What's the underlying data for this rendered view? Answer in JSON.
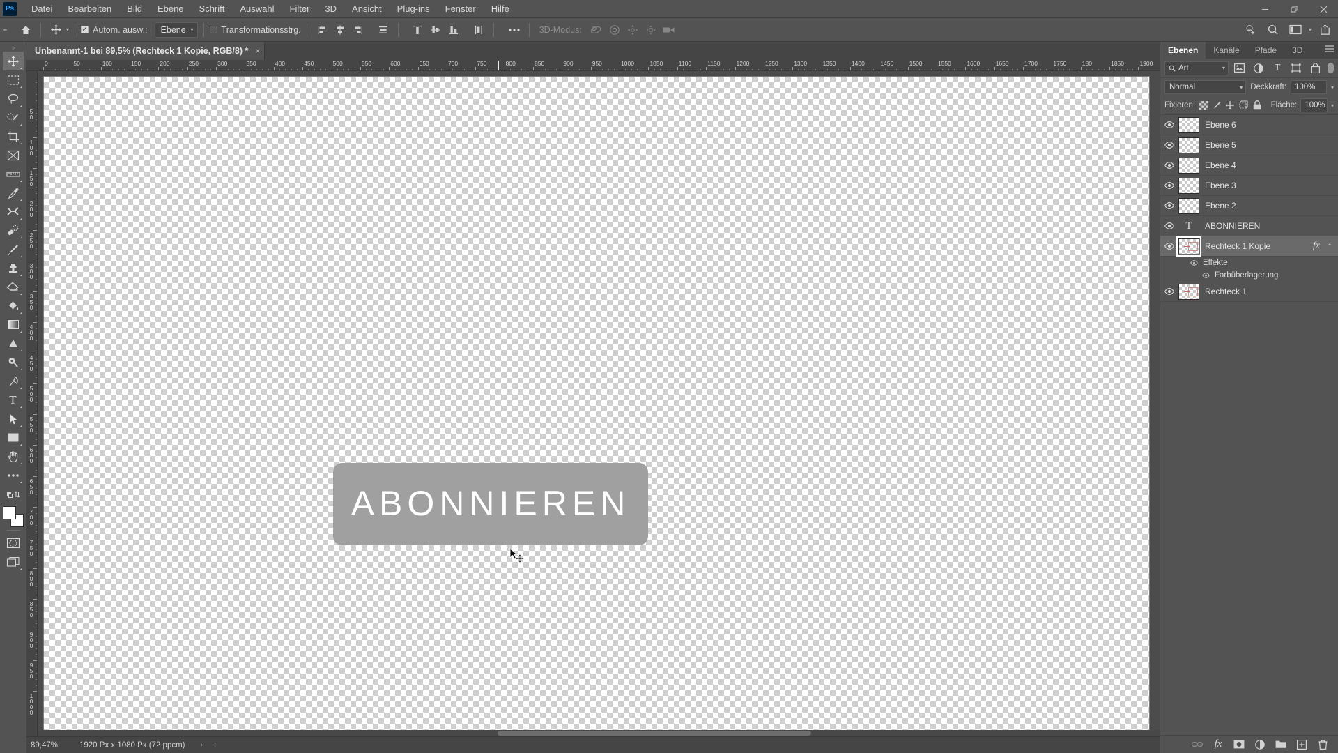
{
  "app": {
    "logo": "Ps"
  },
  "menubar": {
    "items": [
      "Datei",
      "Bearbeiten",
      "Bild",
      "Ebene",
      "Schrift",
      "Auswahl",
      "Filter",
      "3D",
      "Ansicht",
      "Plug-ins",
      "Fenster",
      "Hilfe"
    ],
    "window_controls": [
      "minimize-icon",
      "restore-icon",
      "close-icon"
    ]
  },
  "options_bar": {
    "home_icon": "home-icon",
    "tool_icon": "move-tool-icon",
    "auto_select": {
      "label": "Autom. ausw.:",
      "checked": true
    },
    "auto_select_scope": {
      "value": "Ebene"
    },
    "transform_controls": {
      "label": "Transformationsstrg.",
      "checked": false
    },
    "align_group_1": [
      "align-left-icon",
      "align-center-horizontal-icon",
      "align-right-icon",
      "distribute-horizontal-icon"
    ],
    "align_group_2": [
      "align-top-icon",
      "align-middle-vertical-icon",
      "align-bottom-icon",
      "distribute-vertical-icon"
    ],
    "more_icon": "more-options-icon",
    "three_d_mode": {
      "label": "3D-Modus:",
      "icons": [
        "orbit-3d-icon",
        "roll-3d-icon",
        "pan-3d-icon",
        "slide-3d-icon",
        "scale-3d-icon"
      ]
    },
    "right_icons": [
      "share-proof-icon",
      "search-icon",
      "workspace-icon",
      "chevron-down-icon",
      "export-icon"
    ]
  },
  "document_tab": {
    "title": "Unbenannt-1 bei 89,5% (Rechteck 1 Kopie, RGB/8) *",
    "close": "×"
  },
  "toolbar": {
    "tools": [
      {
        "name": "move-tool",
        "selected": true
      },
      {
        "name": "rectangular-marquee-tool",
        "selected": false
      },
      {
        "name": "lasso-tool",
        "selected": false
      },
      {
        "name": "object-selection-tool",
        "selected": false
      },
      {
        "name": "crop-tool",
        "selected": false
      },
      {
        "name": "frame-tool",
        "selected": false
      },
      {
        "name": "eyedropper-ruler-tool",
        "selected": false
      },
      {
        "name": "eyedropper-tool",
        "selected": false
      },
      {
        "name": "spot-healing-brush-tool",
        "selected": false
      },
      {
        "name": "patch-tool",
        "selected": false
      },
      {
        "name": "brush-tool",
        "selected": false
      },
      {
        "name": "clone-stamp-tool",
        "selected": false
      },
      {
        "name": "eraser-tool",
        "selected": false
      },
      {
        "name": "paint-bucket-tool",
        "selected": false
      },
      {
        "name": "gradient-tool",
        "selected": false
      },
      {
        "name": "blur-sharpen-tool",
        "selected": false
      },
      {
        "name": "dodge-burn-tool",
        "selected": false
      },
      {
        "name": "pen-tool",
        "selected": false
      },
      {
        "name": "type-tool",
        "selected": false
      },
      {
        "name": "path-selection-tool",
        "selected": false
      },
      {
        "name": "rectangle-shape-tool",
        "selected": false
      },
      {
        "name": "hand-tool",
        "selected": false
      },
      {
        "name": "more-tools",
        "selected": false
      },
      {
        "name": "edit-toolbar",
        "selected": false
      }
    ],
    "foreground_color": "#ffffff",
    "background_color": "#ffffff",
    "quick_mask_icon": "quick-mask-icon",
    "screen_mode_icon": "screen-mode-icon"
  },
  "rulers": {
    "h_ticks": [
      "0",
      "50",
      "100",
      "150",
      "200",
      "250",
      "300",
      "350",
      "400",
      "450",
      "500",
      "550",
      "600",
      "650",
      "700",
      "750",
      "800",
      "850",
      "900",
      "950",
      "1000",
      "1050",
      "1100",
      "1150",
      "1200",
      "1250",
      "1300",
      "1350",
      "1400",
      "1450",
      "1500",
      "1550",
      "1600",
      "1650",
      "1700",
      "1750",
      "1800"
    ],
    "v_ticks": [
      "50",
      "100",
      "150",
      "200",
      "250",
      "300",
      "350",
      "400",
      "450",
      "500",
      "550",
      "600",
      "650",
      "700",
      "750",
      "800",
      "850",
      "900",
      "950"
    ],
    "unit": "Px"
  },
  "canvas": {
    "button_text": "ABONNIEREN",
    "button_fill": "#a0a0a0",
    "text_color": "#ffffff",
    "cursor": "move-cursor"
  },
  "status_bar": {
    "zoom": "89,47%",
    "doc_info": "1920 Px x 1080 Px (72 ppcm)",
    "next_arrow": "›",
    "prev_arrow": "‹"
  },
  "panel": {
    "tabs": [
      {
        "label": "Ebenen",
        "active": true
      },
      {
        "label": "Kanäle",
        "active": false
      },
      {
        "label": "Pfade",
        "active": false
      },
      {
        "label": "3D",
        "active": false
      }
    ],
    "menu_icon": "panel-menu-icon",
    "filter": {
      "search_icon": "search-icon",
      "value": "Art",
      "icons": [
        "pixel-layers-filter-icon",
        "adjustment-layers-filter-icon",
        "type-layers-filter-icon",
        "shape-layers-filter-icon",
        "smart-object-filter-icon"
      ],
      "toggle": "filter-toggle"
    },
    "blend": {
      "mode": "Normal",
      "opacity_label": "Deckkraft:",
      "opacity_value": "100%"
    },
    "lock": {
      "label": "Fixieren:",
      "icons": [
        "lock-transparency-icon",
        "lock-image-icon",
        "lock-position-icon",
        "lock-artboard-icon",
        "lock-all-icon"
      ],
      "fill_label": "Fläche:",
      "fill_value": "100%"
    },
    "layers": [
      {
        "name": "Ebene 6",
        "kind": "pixel",
        "visible": true,
        "selected": false
      },
      {
        "name": "Ebene 5",
        "kind": "pixel",
        "visible": true,
        "selected": false
      },
      {
        "name": "Ebene 4",
        "kind": "pixel",
        "visible": true,
        "selected": false
      },
      {
        "name": "Ebene 3",
        "kind": "pixel",
        "visible": true,
        "selected": false
      },
      {
        "name": "Ebene 2",
        "kind": "pixel",
        "visible": true,
        "selected": false
      },
      {
        "name": "ABONNIEREN",
        "kind": "type",
        "visible": true,
        "selected": false
      },
      {
        "name": "Rechteck 1 Kopie",
        "kind": "shape",
        "visible": true,
        "selected": true,
        "fx": "fx",
        "expanded": true,
        "effects": {
          "group": "Effekte",
          "items": [
            "Farbüberlagerung"
          ]
        }
      },
      {
        "name": "Rechteck 1",
        "kind": "shape",
        "visible": true,
        "selected": false
      }
    ],
    "footer_icons": [
      "link-layers-icon",
      "layer-style-fx-icon",
      "layer-mask-icon",
      "adjustment-layer-icon",
      "new-group-icon",
      "new-layer-icon",
      "delete-layer-icon"
    ]
  }
}
